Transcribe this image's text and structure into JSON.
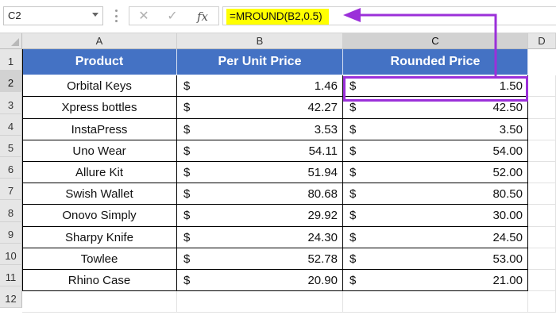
{
  "name_box": {
    "value": "C2"
  },
  "formula_bar": {
    "cancel_icon": "✕",
    "enter_icon": "✓",
    "fx_label": "fx",
    "formula": "=MROUND(B2,0.5)"
  },
  "columns": [
    "A",
    "B",
    "C",
    "D"
  ],
  "rows": [
    "1",
    "2",
    "3",
    "4",
    "5",
    "6",
    "7",
    "8",
    "9",
    "10",
    "11",
    "12"
  ],
  "table": {
    "headers": [
      "Product",
      "Per Unit Price",
      "Rounded Price"
    ],
    "currency": "$",
    "data": [
      {
        "product": "Orbital Keys",
        "price": "1.46",
        "rounded": "1.50"
      },
      {
        "product": "Xpress bottles",
        "price": "42.27",
        "rounded": "42.50"
      },
      {
        "product": "InstaPress",
        "price": "3.53",
        "rounded": "3.50"
      },
      {
        "product": "Uno Wear",
        "price": "54.11",
        "rounded": "54.00"
      },
      {
        "product": "Allure Kit",
        "price": "51.94",
        "rounded": "52.00"
      },
      {
        "product": "Swish Wallet",
        "price": "80.68",
        "rounded": "80.50"
      },
      {
        "product": "Onovo Simply",
        "price": "29.92",
        "rounded": "30.00"
      },
      {
        "product": "Sharpy Knife",
        "price": "24.30",
        "rounded": "24.50"
      },
      {
        "product": "Towlee",
        "price": "52.78",
        "rounded": "53.00"
      },
      {
        "product": "Rhino Case",
        "price": "20.90",
        "rounded": "21.00"
      }
    ]
  },
  "colors": {
    "header_fill": "#4472c4",
    "annotation": "#9b30d9",
    "formula_highlight": "#ffff00"
  }
}
